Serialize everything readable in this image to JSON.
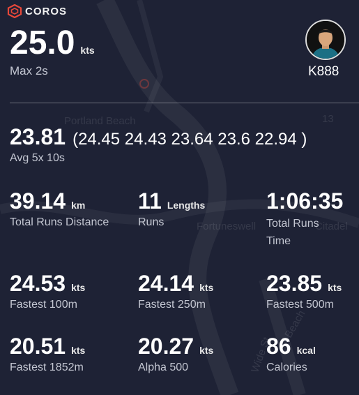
{
  "brand": {
    "name": "COROS",
    "accent": "#e8483a"
  },
  "user": {
    "name": "K888"
  },
  "max": {
    "value": "25.0",
    "unit": "kts",
    "label": "Max 2s"
  },
  "avg": {
    "value": "23.81",
    "details": "(24.45 24.43 23.64 23.6 22.94 )",
    "label": "Avg 5x 10s"
  },
  "map_labels": [
    "Portland Beach",
    "13",
    "Fortuneswell",
    "Citadel",
    "Wide St",
    "Beach"
  ],
  "stats": [
    {
      "value": "39.14",
      "unit": "km",
      "label": "Total Runs Distance"
    },
    {
      "value": "11",
      "unit": "Lengths",
      "label": "Runs"
    },
    {
      "value": "1:06:35",
      "unit": "",
      "label": "Total Runs Time"
    },
    {
      "value": "24.53",
      "unit": "kts",
      "label": "Fastest 100m"
    },
    {
      "value": "24.14",
      "unit": "kts",
      "label": "Fastest 250m"
    },
    {
      "value": "23.85",
      "unit": "kts",
      "label": "Fastest 500m"
    },
    {
      "value": "20.51",
      "unit": "kts",
      "label": "Fastest 1852m"
    },
    {
      "value": "20.27",
      "unit": "kts",
      "label": "Alpha 500"
    },
    {
      "value": "86",
      "unit": "kcal",
      "label": "Calories"
    }
  ]
}
